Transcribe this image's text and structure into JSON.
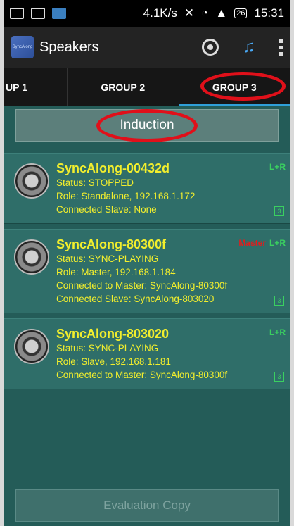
{
  "status_bar": {
    "speed": "4.1K/s",
    "battery": "26",
    "time": "15:31"
  },
  "action_bar": {
    "title": "Speakers",
    "logo_text": "SyncAlong"
  },
  "tabs": [
    {
      "label": "UP 1"
    },
    {
      "label": "GROUP 2"
    },
    {
      "label": "GROUP 3",
      "active": true
    }
  ],
  "induction_label": "Induction",
  "speakers": [
    {
      "name": "SyncAlong-00432d",
      "lines": [
        "Status: STOPPED",
        "Role: Standalone,  192.168.1.172",
        "Connected Slave: None"
      ],
      "master": "",
      "channel": "L+R",
      "badge": "3"
    },
    {
      "name": "SyncAlong-80300f",
      "lines": [
        "Status: SYNC-PLAYING",
        "Role: Master,  192.168.1.184",
        "Connected to Master: SyncAlong-80300f",
        "Connected Slave: SyncAlong-803020"
      ],
      "master": "Master",
      "channel": "L+R",
      "badge": "3"
    },
    {
      "name": "SyncAlong-803020",
      "lines": [
        "Status: SYNC-PLAYING",
        "Role: Slave,  192.168.1.181",
        "Connected to Master: SyncAlong-80300f"
      ],
      "master": "",
      "channel": "L+R",
      "badge": "3"
    }
  ],
  "evaluation_label": "Evaluation Copy",
  "colors": {
    "accent": "#2f9fd8",
    "text_yellow": "#f2ee2d",
    "highlight_red": "#e0101a",
    "channel_green": "#3ad060"
  }
}
